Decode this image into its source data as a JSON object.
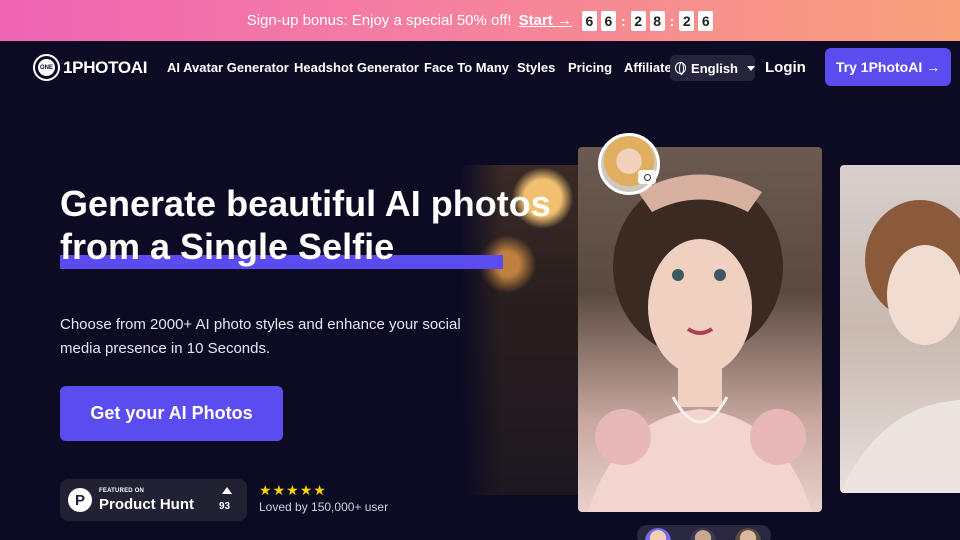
{
  "promo": {
    "text": "Sign-up bonus: Enjoy a special 50% off!",
    "start_label": "Start →",
    "countdown": [
      "6",
      "6",
      "2",
      "8",
      "2",
      "6"
    ]
  },
  "nav": {
    "logo_mark": "ONE",
    "logo_text": "1PHOTOAI",
    "links": [
      "AI Avatar Generator",
      "Headshot Generator",
      "Face To Many",
      "Styles",
      "Pricing",
      "Affiliates"
    ],
    "language": "English",
    "login": "Login",
    "try_label": "Try 1PhotoAI →"
  },
  "hero": {
    "title_line1": "Generate beautiful AI photos",
    "title_line2": "from a Single Selfie",
    "subtitle": "Choose from 2000+ AI photo styles and enhance your social media presence in 10 Seconds.",
    "cta_label": "Get your AI Photos"
  },
  "product_hunt": {
    "featured_on": "FEATURED ON",
    "name": "Product Hunt",
    "icon_letter": "P",
    "votes": "93"
  },
  "rating": {
    "stars": 5,
    "loved_text": "Loved by 150,000+ user"
  },
  "colors": {
    "accent": "#5b4cf0",
    "background": "#0d0b24",
    "star": "#f5d200"
  }
}
